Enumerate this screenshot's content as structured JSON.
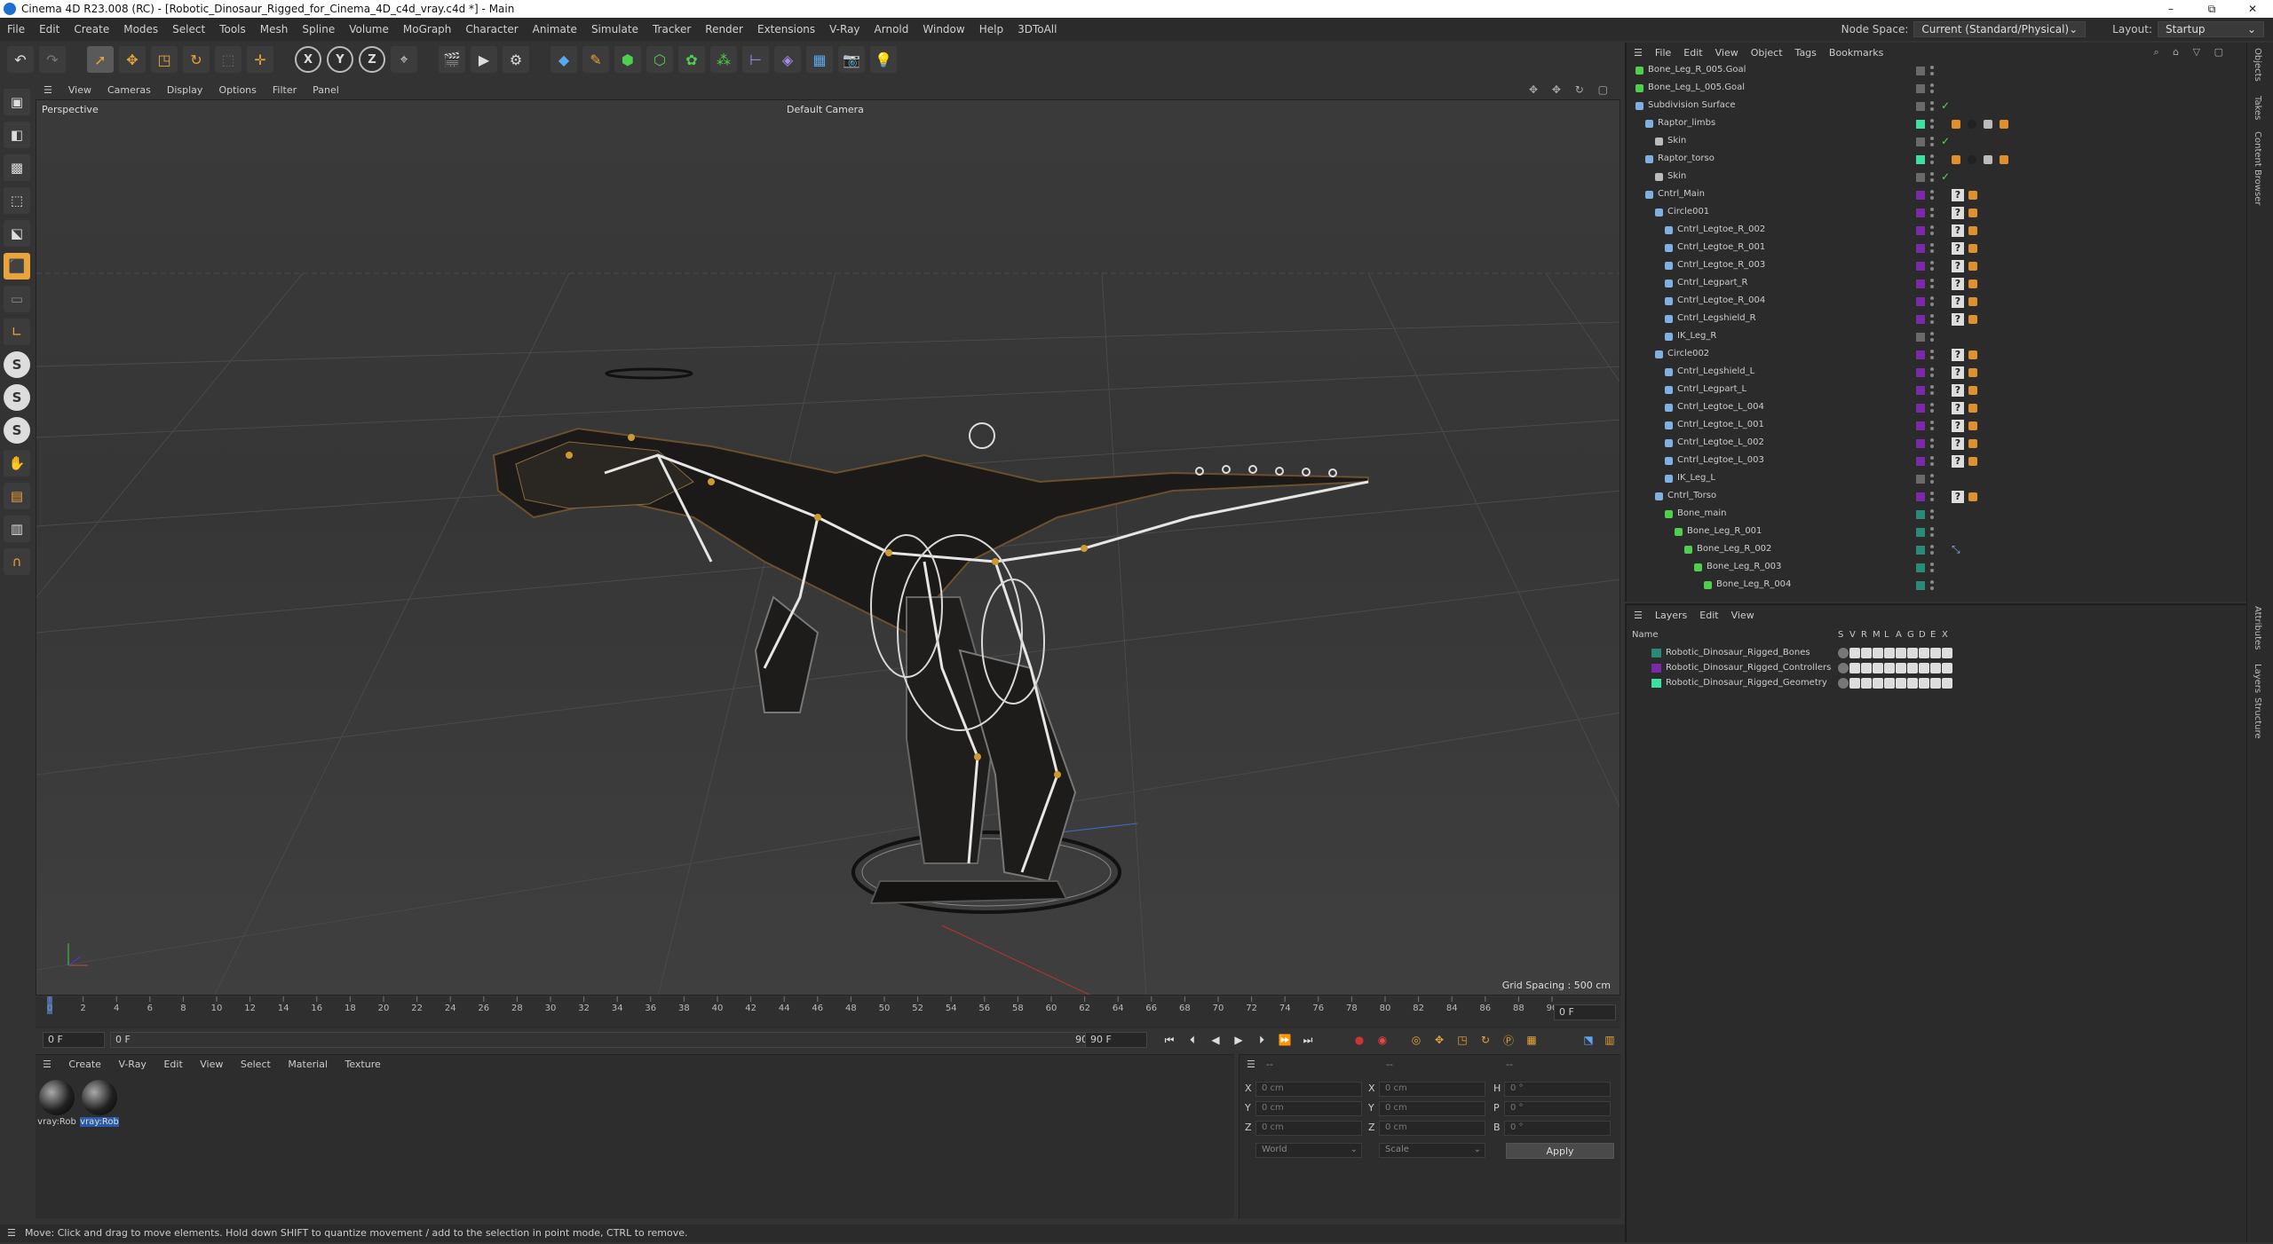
{
  "window": {
    "title": "Cinema 4D R23.008 (RC) - [Robotic_Dinosaur_Rigged_for_Cinema_4D_c4d_vray.c4d *] - Main",
    "minimize": "–",
    "maximize": "⧉",
    "close": "✕"
  },
  "menubar": {
    "items": [
      "File",
      "Edit",
      "Create",
      "Modes",
      "Select",
      "Tools",
      "Mesh",
      "Spline",
      "Volume",
      "MoGraph",
      "Character",
      "Animate",
      "Simulate",
      "Tracker",
      "Render",
      "Extensions",
      "V-Ray",
      "Arnold",
      "Window",
      "Help",
      "3DToAll"
    ],
    "node_space_label": "Node Space:",
    "node_space_value": "Current (Standard/Physical)",
    "layout_label": "Layout:",
    "layout_value": "Startup"
  },
  "toolbar": {
    "axis_x": "X",
    "axis_y": "Y",
    "axis_z": "Z"
  },
  "lefttools": {
    "s1": "S",
    "s2": "S",
    "s3": "S"
  },
  "viewport": {
    "menu": [
      "View",
      "Cameras",
      "Display",
      "Options",
      "Filter",
      "Panel"
    ],
    "projection": "Perspective",
    "camera": "Default Camera",
    "grid_spacing": "Grid Spacing : 500 cm"
  },
  "timeline": {
    "ticks": [
      "0",
      "2",
      "4",
      "6",
      "8",
      "10",
      "12",
      "14",
      "16",
      "18",
      "20",
      "22",
      "24",
      "26",
      "28",
      "30",
      "32",
      "34",
      "36",
      "38",
      "40",
      "42",
      "44",
      "46",
      "48",
      "50",
      "52",
      "54",
      "56",
      "58",
      "60",
      "62",
      "64",
      "66",
      "68",
      "70",
      "72",
      "74",
      "76",
      "78",
      "80",
      "82",
      "84",
      "86",
      "88",
      "90"
    ],
    "current_frame_field": "0 F",
    "start_field": "0 F",
    "range_start": "0 F",
    "range_end": "90 F",
    "end_field": "90 F"
  },
  "materials": {
    "menu": [
      "Create",
      "V-Ray",
      "Edit",
      "View",
      "Select",
      "Material",
      "Texture"
    ],
    "items": [
      {
        "label": "vray:Rob"
      },
      {
        "label": "vray:Rob"
      }
    ]
  },
  "coords": {
    "header_left": "--",
    "header_mid": "--",
    "header_right": "--",
    "x_label": "X",
    "y_label": "Y",
    "z_label": "Z",
    "x2_label": "X",
    "y2_label": "Y",
    "z2_label": "Z",
    "h_label": "H",
    "p_label": "P",
    "b_label": "B",
    "pos_x": "0 cm",
    "pos_y": "0 cm",
    "pos_z": "0 cm",
    "size_x": "0 cm",
    "size_y": "0 cm",
    "size_z": "0 cm",
    "rot_h": "0 °",
    "rot_p": "0 °",
    "rot_b": "0 °",
    "mode_select": "World",
    "scale_select": "Scale",
    "apply": "Apply"
  },
  "status": {
    "text": "Move: Click and drag to move elements. Hold down SHIFT to quantize movement / add to the selection in point mode, CTRL to remove."
  },
  "objects": {
    "menu": [
      "File",
      "Edit",
      "View",
      "Object",
      "Tags",
      "Bookmarks"
    ],
    "rows": [
      {
        "name": "Bone_Leg_R_005.Goal",
        "indent": 0,
        "color": "#6a6a6a",
        "tags": ""
      },
      {
        "name": "Bone_Leg_L_005.Goal",
        "indent": 0,
        "color": "#6a6a6a",
        "tags": ""
      },
      {
        "name": "Subdivision Surface",
        "indent": 0,
        "color": "#6a6a6a",
        "tags": "check"
      },
      {
        "name": "Raptor_limbs",
        "indent": 1,
        "color": "#3ee0a0",
        "tags": "mat"
      },
      {
        "name": "Skin",
        "indent": 2,
        "color": "#6a6a6a",
        "tags": "check"
      },
      {
        "name": "Raptor_torso",
        "indent": 1,
        "color": "#3ee0a0",
        "tags": "mat"
      },
      {
        "name": "Skin",
        "indent": 2,
        "color": "#6a6a6a",
        "tags": "check"
      },
      {
        "name": "Cntrl_Main",
        "indent": 1,
        "color": "#7a2aa8",
        "tags": "q"
      },
      {
        "name": "Circle001",
        "indent": 2,
        "color": "#7a2aa8",
        "tags": "q"
      },
      {
        "name": "Cntrl_Legtoe_R_002",
        "indent": 3,
        "color": "#7a2aa8",
        "tags": "q"
      },
      {
        "name": "Cntrl_Legtoe_R_001",
        "indent": 3,
        "color": "#7a2aa8",
        "tags": "q"
      },
      {
        "name": "Cntrl_Legtoe_R_003",
        "indent": 3,
        "color": "#7a2aa8",
        "tags": "q"
      },
      {
        "name": "Cntrl_Legpart_R",
        "indent": 3,
        "color": "#7a2aa8",
        "tags": "q"
      },
      {
        "name": "Cntrl_Legtoe_R_004",
        "indent": 3,
        "color": "#7a2aa8",
        "tags": "q"
      },
      {
        "name": "Cntrl_Legshield_R",
        "indent": 3,
        "color": "#7a2aa8",
        "tags": "q"
      },
      {
        "name": "IK_Leg_R",
        "indent": 3,
        "color": "#6a6a6a",
        "tags": ""
      },
      {
        "name": "Circle002",
        "indent": 2,
        "color": "#7a2aa8",
        "tags": "q"
      },
      {
        "name": "Cntrl_Legshield_L",
        "indent": 3,
        "color": "#7a2aa8",
        "tags": "q"
      },
      {
        "name": "Cntrl_Legpart_L",
        "indent": 3,
        "color": "#7a2aa8",
        "tags": "q"
      },
      {
        "name": "Cntrl_Legtoe_L_004",
        "indent": 3,
        "color": "#7a2aa8",
        "tags": "q"
      },
      {
        "name": "Cntrl_Legtoe_L_001",
        "indent": 3,
        "color": "#7a2aa8",
        "tags": "q"
      },
      {
        "name": "Cntrl_Legtoe_L_002",
        "indent": 3,
        "color": "#7a2aa8",
        "tags": "q"
      },
      {
        "name": "Cntrl_Legtoe_L_003",
        "indent": 3,
        "color": "#7a2aa8",
        "tags": "q"
      },
      {
        "name": "IK_Leg_L",
        "indent": 3,
        "color": "#6a6a6a",
        "tags": ""
      },
      {
        "name": "Cntrl_Torso",
        "indent": 2,
        "color": "#7a2aa8",
        "tags": "q"
      },
      {
        "name": "Bone_main",
        "indent": 3,
        "color": "#2a8a78",
        "tags": ""
      },
      {
        "name": "Bone_Leg_R_001",
        "indent": 4,
        "color": "#2a8a78",
        "tags": ""
      },
      {
        "name": "Bone_Leg_R_002",
        "indent": 5,
        "color": "#2a8a78",
        "tags": "ik"
      },
      {
        "name": "Bone_Leg_R_003",
        "indent": 6,
        "color": "#2a8a78",
        "tags": ""
      },
      {
        "name": "Bone_Leg_R_004",
        "indent": 7,
        "color": "#2a8a78",
        "tags": ""
      }
    ]
  },
  "layers": {
    "menu": [
      "Layers",
      "Edit",
      "View"
    ],
    "col_name": "Name",
    "col_flags": [
      "S",
      "V",
      "R",
      "M",
      "L",
      "A",
      "G",
      "D",
      "E",
      "X"
    ],
    "rows": [
      {
        "name": "Robotic_Dinosaur_Rigged_Bones",
        "color": "#2a8a78"
      },
      {
        "name": "Robotic_Dinosaur_Rigged_Controllers",
        "color": "#7a2aa8"
      },
      {
        "name": "Robotic_Dinosaur_Rigged_Geometry",
        "color": "#3ee0a0"
      }
    ]
  },
  "sidetabs": [
    "Objects",
    "Takes",
    "Content Browser",
    "Attributes",
    "Layers",
    "Structure"
  ]
}
